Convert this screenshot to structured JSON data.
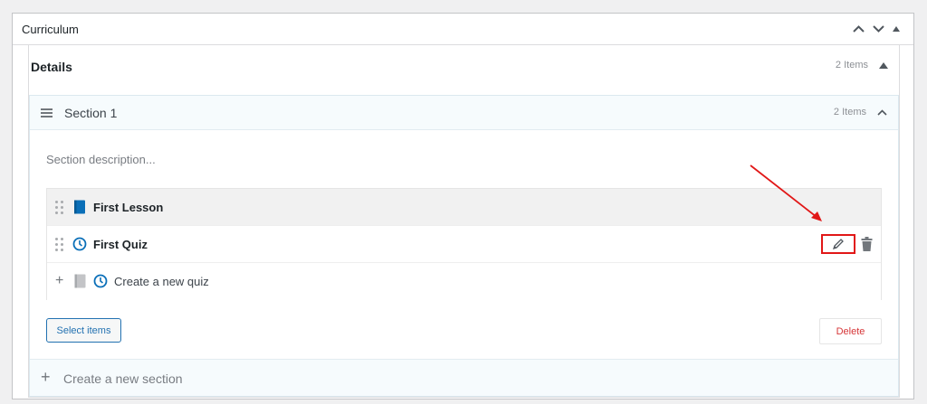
{
  "panel": {
    "title": "Curriculum"
  },
  "details": {
    "title": "Details",
    "count": "2 Items"
  },
  "section": {
    "name": "Section 1",
    "count": "2 Items",
    "description_placeholder": "Section description..."
  },
  "items": [
    {
      "name": "First Lesson",
      "type_icon": "book-icon"
    },
    {
      "name": "First Quiz",
      "type_icon": "clock-icon"
    }
  ],
  "new_item": {
    "placeholder": "Create a new quiz"
  },
  "buttons": {
    "select_items": "Select items",
    "delete": "Delete"
  },
  "new_section": {
    "placeholder": "Create a new section"
  },
  "colors": {
    "accent": "#2271b1",
    "danger": "#d63638",
    "highlight": "#e11717",
    "lesson_icon": "#0a6fb8"
  }
}
